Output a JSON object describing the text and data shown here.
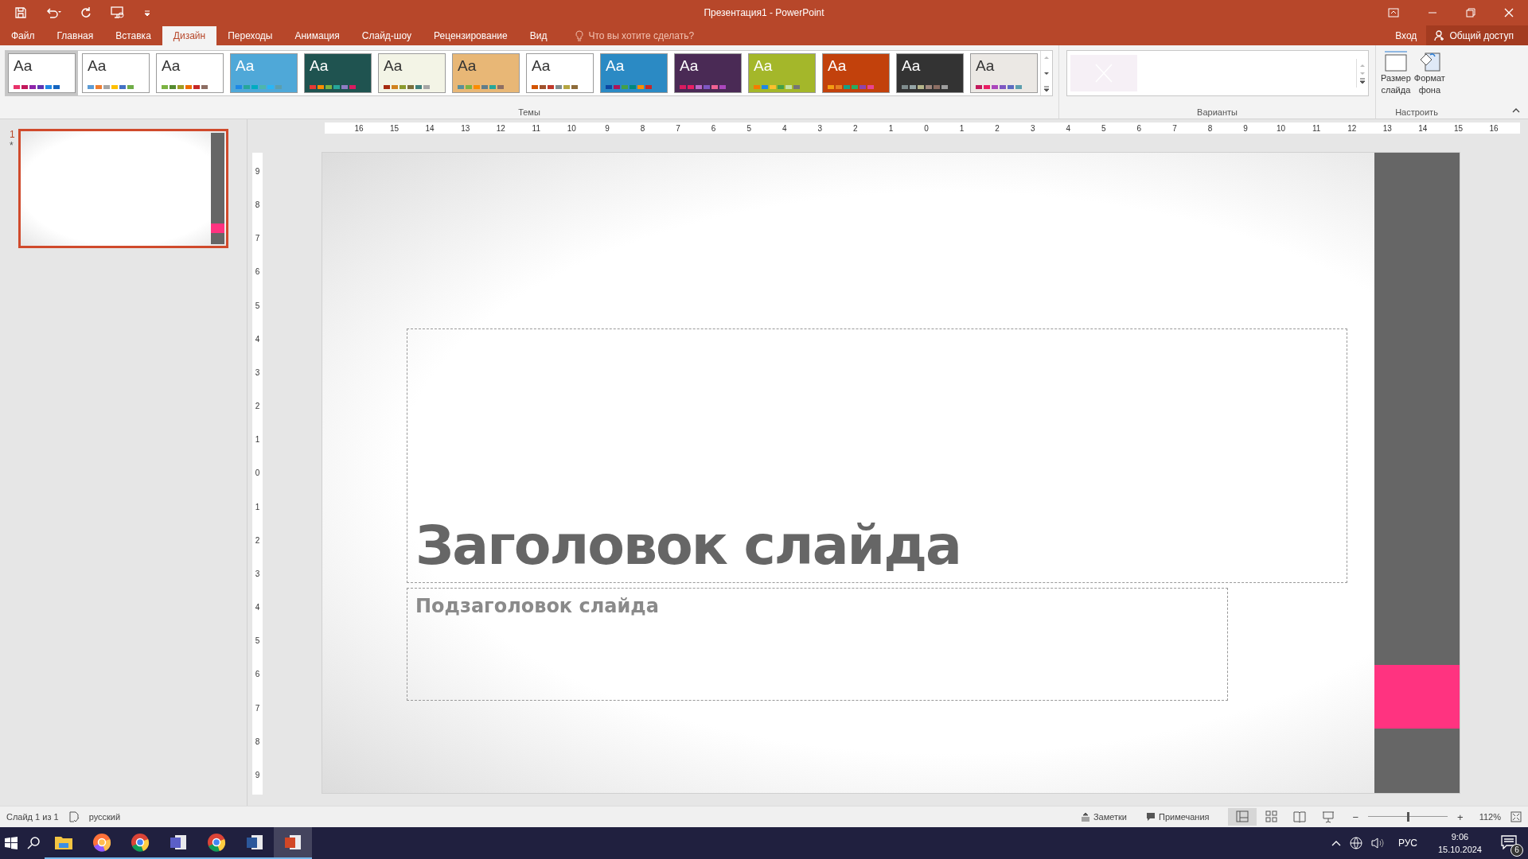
{
  "window": {
    "title": "Презентация1 - PowerPoint"
  },
  "menu_tabs": [
    {
      "label": "Файл",
      "selected": false
    },
    {
      "label": "Главная",
      "selected": false
    },
    {
      "label": "Вставка",
      "selected": false
    },
    {
      "label": "Дизайн",
      "selected": true
    },
    {
      "label": "Переходы",
      "selected": false
    },
    {
      "label": "Анимация",
      "selected": false
    },
    {
      "label": "Слайд-шоу",
      "selected": false
    },
    {
      "label": "Рецензирование",
      "selected": false
    },
    {
      "label": "Вид",
      "selected": false
    }
  ],
  "tell_me": {
    "placeholder": "Что вы хотите сделать?"
  },
  "account": {
    "sign_in": "Вход",
    "share": "Общий доступ"
  },
  "themes": [
    {
      "label": "Aa",
      "selected": true,
      "color": "#ffffff",
      "swatches": [
        {
          "color": "#e8336b"
        },
        {
          "color": "#c2185b"
        },
        {
          "color": "#8e24aa"
        },
        {
          "color": "#5e35b1"
        },
        {
          "color": "#1e88e5"
        },
        {
          "color": "#1565c0"
        }
      ]
    },
    {
      "label": "Aa",
      "selected": false,
      "color": "#ffffff",
      "swatches": [
        {
          "color": "#5b9bd5"
        },
        {
          "color": "#ed7d31"
        },
        {
          "color": "#a5a5a5"
        },
        {
          "color": "#ffc000"
        },
        {
          "color": "#4472c4"
        },
        {
          "color": "#70ad47"
        }
      ]
    },
    {
      "label": "Aa",
      "selected": false,
      "color": "#ffffff",
      "swatches": [
        {
          "color": "#7cb342"
        },
        {
          "color": "#558b2f"
        },
        {
          "color": "#9e9d24"
        },
        {
          "color": "#ef6c00"
        },
        {
          "color": "#c62828"
        },
        {
          "color": "#8d6e63"
        }
      ]
    },
    {
      "label": "Aa",
      "selected": false,
      "color": "#4fa8d8",
      "swatches": [
        {
          "color": "#1e88e5"
        },
        {
          "color": "#26a69a"
        },
        {
          "color": "#00acc1"
        },
        {
          "color": "#4db6ac"
        },
        {
          "color": "#29b6f6"
        },
        {
          "color": "#5c9ead"
        }
      ]
    },
    {
      "label": "Aa",
      "selected": false,
      "color": "#1f5350",
      "swatches": [
        {
          "color": "#e53935"
        },
        {
          "color": "#fb8c00"
        },
        {
          "color": "#7cb342"
        },
        {
          "color": "#26a69a"
        },
        {
          "color": "#8e7cc3"
        },
        {
          "color": "#d81b60"
        }
      ]
    },
    {
      "label": "Aa",
      "selected": false,
      "color": "#f3f4e6",
      "swatches": [
        {
          "color": "#a62b10"
        },
        {
          "color": "#d0821e"
        },
        {
          "color": "#8b9a2d"
        },
        {
          "color": "#7b6e3b"
        },
        {
          "color": "#3f7f7a"
        },
        {
          "color": "#a6a6a6"
        }
      ]
    },
    {
      "label": "Aa",
      "selected": false,
      "color": "#e8b776",
      "swatches": [
        {
          "color": "#5b8f9a"
        },
        {
          "color": "#7cb342"
        },
        {
          "color": "#fb8c00"
        },
        {
          "color": "#607d8b"
        },
        {
          "color": "#26a69a"
        },
        {
          "color": "#8d6e63"
        }
      ]
    },
    {
      "label": "Aa",
      "selected": false,
      "color": "#ffffff",
      "swatches": [
        {
          "color": "#d35400"
        },
        {
          "color": "#a0522d"
        },
        {
          "color": "#c0392b"
        },
        {
          "color": "#7f8c8d"
        },
        {
          "color": "#b5a642"
        },
        {
          "color": "#8e6c3a"
        }
      ]
    },
    {
      "label": "Aa",
      "selected": false,
      "color": "#2b8ac4",
      "swatches": [
        {
          "color": "#0d47a1"
        },
        {
          "color": "#ad1457"
        },
        {
          "color": "#43a047"
        },
        {
          "color": "#00897b"
        },
        {
          "color": "#fb8c00"
        },
        {
          "color": "#c62828"
        }
      ]
    },
    {
      "label": "Aa",
      "selected": false,
      "color": "#4a2a55",
      "swatches": [
        {
          "color": "#d81b60"
        },
        {
          "color": "#e91e63"
        },
        {
          "color": "#ba68c8"
        },
        {
          "color": "#7e57c2"
        },
        {
          "color": "#f06292"
        },
        {
          "color": "#ab47bc"
        }
      ]
    },
    {
      "label": "Aa",
      "selected": false,
      "color": "#a4b72a",
      "swatches": [
        {
          "color": "#f57c00"
        },
        {
          "color": "#1e88e5"
        },
        {
          "color": "#fbc02d"
        },
        {
          "color": "#43a047"
        },
        {
          "color": "#c5e1a5"
        },
        {
          "color": "#757575"
        }
      ]
    },
    {
      "label": "Aa",
      "selected": false,
      "color": "#c2410c",
      "swatches": [
        {
          "color": "#f39c12"
        },
        {
          "color": "#e67e22"
        },
        {
          "color": "#16a085"
        },
        {
          "color": "#27ae60"
        },
        {
          "color": "#8e44ad"
        },
        {
          "color": "#e84393"
        }
      ]
    },
    {
      "label": "Aa",
      "selected": false,
      "color": "#333333",
      "swatches": [
        {
          "color": "#7f8c8d"
        },
        {
          "color": "#95a5a6"
        },
        {
          "color": "#b5b58a"
        },
        {
          "color": "#a1887f"
        },
        {
          "color": "#8d6e63"
        },
        {
          "color": "#9e9e9e"
        }
      ]
    },
    {
      "label": "Aa",
      "selected": false,
      "color": "#ebe8e4",
      "swatches": [
        {
          "color": "#c2185b"
        },
        {
          "color": "#e91e63"
        },
        {
          "color": "#ab47bc"
        },
        {
          "color": "#7e57c2"
        },
        {
          "color": "#5c6bc0"
        },
        {
          "color": "#5c9ead"
        }
      ]
    }
  ],
  "ribbon_groups": {
    "themes": "Темы",
    "variants": "Варианты",
    "customize": "Настроить"
  },
  "customize_buttons": [
    {
      "kind": "slide-size",
      "label": "Размер\nслайда"
    },
    {
      "kind": "format-background",
      "label": "Формат\nфона"
    }
  ],
  "slide_pane": {
    "number": "1",
    "mark": "*"
  },
  "ruler": {
    "horizontal": [
      "16",
      "15",
      "14",
      "13",
      "12",
      "11",
      "10",
      "9",
      "8",
      "7",
      "6",
      "5",
      "4",
      "3",
      "2",
      "1",
      "0",
      "1",
      "2",
      "3",
      "4",
      "5",
      "6",
      "7",
      "8",
      "9",
      "10",
      "11",
      "12",
      "13",
      "14",
      "15",
      "16"
    ],
    "vertical": [
      "9",
      "8",
      "7",
      "6",
      "5",
      "4",
      "3",
      "2",
      "1",
      "0",
      "1",
      "2",
      "3",
      "4",
      "5",
      "6",
      "7",
      "8",
      "9"
    ]
  },
  "slide": {
    "title": "Заголовок слайда",
    "subtitle": "Подзаголовок слайда"
  },
  "status_bar": {
    "slide": "Слайд 1 из 1",
    "language": "русский",
    "notes": "Заметки",
    "comments": "Примечания",
    "zoom": {
      "level": 0.5,
      "minus": "−",
      "plus": "+",
      "reading": "112%"
    }
  },
  "taskbar": {
    "apps": [
      {
        "kind": "explorer",
        "selected": false
      },
      {
        "kind": "firefox",
        "selected": false
      },
      {
        "kind": "chrome",
        "selected": false
      },
      {
        "kind": "teams",
        "selected": false
      },
      {
        "kind": "chrome",
        "selected": false
      },
      {
        "kind": "word",
        "selected": false
      },
      {
        "kind": "powerpoint",
        "selected": true
      }
    ],
    "language": "РУС",
    "time": "9:06",
    "date": "15.10.2024",
    "notifications": "6"
  }
}
